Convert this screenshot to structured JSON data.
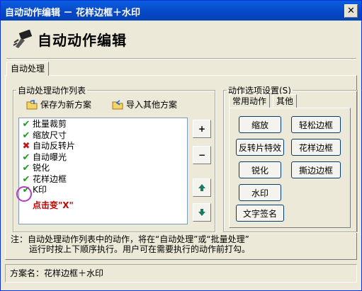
{
  "window": {
    "title": "自动动作编辑 － 花样边框＋水印"
  },
  "header": {
    "title": "自动动作编辑"
  },
  "main_tab": {
    "label": "自动处理"
  },
  "action_list": {
    "legend": "自动处理动作列表",
    "save_label": "保存为新方案",
    "import_label": "导入其他方案",
    "items": [
      {
        "label": "批量裁剪",
        "status": "checked"
      },
      {
        "label": "缩放尺寸",
        "status": "checked"
      },
      {
        "label": "自动反转片",
        "status": "crossed"
      },
      {
        "label": "自动曝光",
        "status": "checked"
      },
      {
        "label": "锐化",
        "status": "checked"
      },
      {
        "label": "花样边框",
        "status": "checked"
      },
      {
        "label": "K印",
        "status": "checked"
      }
    ],
    "annotation": "点击变\"X\"",
    "side_buttons": [
      "+",
      "-",
      "up",
      "down"
    ]
  },
  "options": {
    "legend": "动作选项设置(S)",
    "tabs": [
      "常用动作",
      "其他"
    ],
    "buttons": [
      "缩放",
      "轻松边框",
      "反转片特效",
      "花样边框",
      "锐化",
      "撕边边框",
      "水印",
      "文字签名"
    ]
  },
  "note": {
    "line1": "注：自动处理动作列表中的动作，将在“自动处理”或“批量处理”",
    "line2": "运行时按上下顺序执行。用户可在需要执行的动作前打勾。"
  },
  "status": {
    "scheme": "方案名：花样边框＋水印"
  },
  "colors": {
    "title_bar": "#0a5fe0",
    "check": "#1e9b1e",
    "cross": "#c01818",
    "annotation": "#c00000",
    "highlight_circle": "#b23ac0"
  },
  "icons": {
    "check": "check-icon",
    "cross": "cross-icon",
    "folder": "folder-icon",
    "logo": "edit-brush-icon",
    "close": "close-icon"
  }
}
